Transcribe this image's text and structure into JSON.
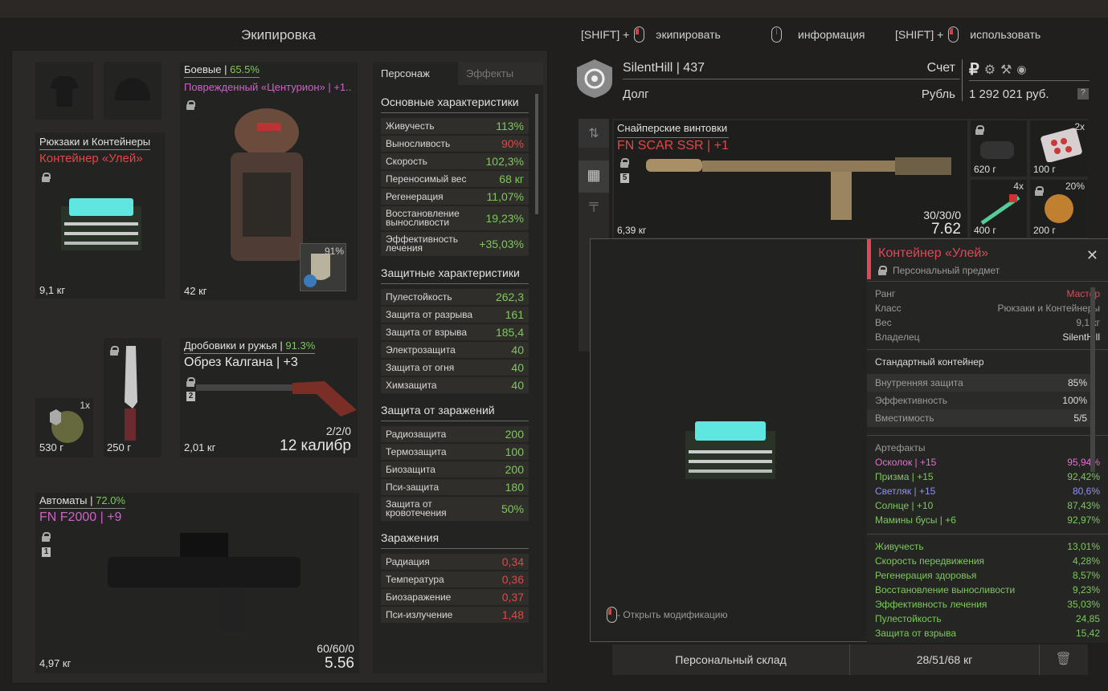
{
  "title": "Экипировка",
  "hints": [
    {
      "prefix": "[SHIFT] +",
      "label": "экипировать"
    },
    {
      "prefix": "",
      "label": "информация"
    },
    {
      "prefix": "[SHIFT] +",
      "label": "использовать"
    }
  ],
  "armor": {
    "category": "Боевые",
    "pct": "65.5%",
    "name": "Поврежденный «Центурион» | +1..",
    "weight": "42 кг",
    "plate_pct": "91%"
  },
  "backpack": {
    "category": "Рюкзаки и Контейнеры",
    "name": "Контейнер «Улей»",
    "weight": "9,1 кг"
  },
  "grenade": {
    "count": "1x",
    "weight": "530 г"
  },
  "knife": {
    "weight": "250 г"
  },
  "shotgun": {
    "category": "Дробовики и ружья",
    "pct": "91.3%",
    "name": "Обрез Калгана | +3",
    "slot": "2",
    "weight": "2,01 кг",
    "ammo": "2/2/0",
    "caliber": "12 калибр"
  },
  "rifle": {
    "category": "Автоматы",
    "pct": "72.0%",
    "name": "FN F2000 | +9",
    "slot": "1",
    "weight": "4,97 кг",
    "ammo": "60/60/0",
    "caliber": "5.56"
  },
  "tabs": [
    "Персонаж",
    "Эффекты"
  ],
  "sections": [
    {
      "title": "Основные характеристики",
      "rows": [
        [
          "Живучесть",
          "113%",
          "green"
        ],
        [
          "Выносливость",
          "90%",
          "red"
        ],
        [
          "Скорость",
          "102,3%",
          "green"
        ],
        [
          "Переносимый вес",
          "68 кг",
          "green"
        ],
        [
          "Регенерация",
          "11,07%",
          "green"
        ],
        [
          "Восстановление выносливости",
          "19,23%",
          "green"
        ],
        [
          "Эффективность лечения",
          "+35,03%",
          "green"
        ]
      ]
    },
    {
      "title": "Защитные характеристики",
      "rows": [
        [
          "Пулестойкость",
          "262,3",
          "green"
        ],
        [
          "Защита от разрыва",
          "161",
          "green"
        ],
        [
          "Защита от взрыва",
          "185,4",
          "green"
        ],
        [
          "Электрозащита",
          "40",
          "green"
        ],
        [
          "Защита от огня",
          "40",
          "green"
        ],
        [
          "Химзащита",
          "40",
          "green"
        ]
      ]
    },
    {
      "title": "Защита от заражений",
      "rows": [
        [
          "Радиозащита",
          "200",
          "green"
        ],
        [
          "Термозащита",
          "100",
          "green"
        ],
        [
          "Биозащита",
          "200",
          "green"
        ],
        [
          "Пси-защита",
          "180",
          "green"
        ],
        [
          "Защита от кровотечения",
          "50%",
          "green"
        ]
      ]
    },
    {
      "title": "Заражения",
      "rows": [
        [
          "Радиация",
          "0,34",
          "red"
        ],
        [
          "Температура",
          "0,36",
          "red"
        ],
        [
          "Биозаражение",
          "0,37",
          "red"
        ],
        [
          "Пси-излучение",
          "1,48",
          "red"
        ]
      ]
    }
  ],
  "player": {
    "name": "SilentHill | 437",
    "debt": "Долг",
    "account": "Счет",
    "currency": "Рубль",
    "money": "1 292 021 руб."
  },
  "sniper": {
    "category": "Снайперские винтовки",
    "name": "FN SCAR SSR | +1",
    "slot": "5",
    "weight": "6,39 кг",
    "ammo": "30/30/0",
    "caliber": "7.62"
  },
  "small_items": [
    {
      "weight": "620 г",
      "count": ""
    },
    {
      "weight": "100 г",
      "count": "2x"
    },
    {
      "weight": "400 г",
      "count": "4x"
    },
    {
      "weight": "200 г",
      "count": "20%"
    }
  ],
  "popup": {
    "name": "Контейнер «Улей»",
    "sub": "Персональный предмет",
    "info": [
      [
        "Ранг",
        "Мастер"
      ],
      [
        "Класс",
        "Рюкзаки и Контейнеры"
      ],
      [
        "Вес",
        "9,1 кг"
      ],
      [
        "Владелец",
        "SilentHill"
      ]
    ],
    "type": "Стандартный контейнер",
    "stats": [
      [
        "Внутренняя защита",
        "85%"
      ],
      [
        "Эффективность",
        "100%"
      ],
      [
        "Вместимость",
        "5/5"
      ]
    ],
    "art_title": "Артефакты",
    "artifacts": [
      [
        "Осколок | +15",
        "95,94%",
        "#e070d0"
      ],
      [
        "Призма | +15",
        "92,42%",
        "#7ec85c"
      ],
      [
        "Светляк | +15",
        "80,6%",
        "#9090f0"
      ],
      [
        "Солнце | +10",
        "87,43%",
        "#7ec85c"
      ],
      [
        "Мамины бусы | +6",
        "92,97%",
        "#7ec85c"
      ]
    ],
    "bonuses": [
      [
        "Живучесть",
        "13,01%"
      ],
      [
        "Скорость передвижения",
        "4,28%"
      ],
      [
        "Регенерация здоровья",
        "8,57%"
      ],
      [
        "Восстановление выносливости",
        "9,23%"
      ],
      [
        "Эффективность лечения",
        "35,03%"
      ],
      [
        "Пулестойкость",
        "24,85"
      ],
      [
        "Защита от взрыва",
        "15,42"
      ]
    ],
    "hint": "- Открыть модификацию"
  },
  "storage": {
    "label": "Персональный склад",
    "weight": "28/51/68 кг"
  }
}
